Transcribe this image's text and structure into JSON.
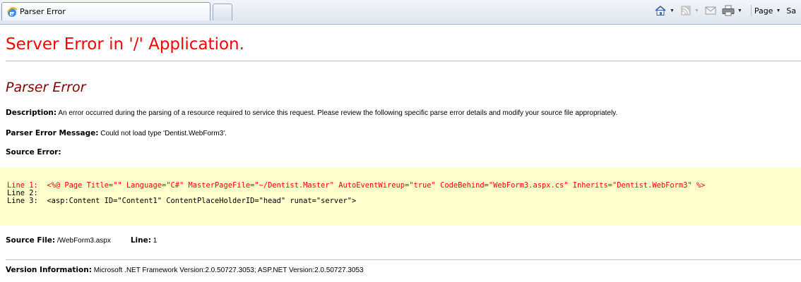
{
  "browser": {
    "tab_title": "Parser Error",
    "page_menu_label": "Page",
    "safety_menu_label_partial": "Sa",
    "icons": [
      "ie-logo-icon",
      "home-icon",
      "rss-feed-icon",
      "read-mail-icon",
      "print-icon"
    ]
  },
  "page": {
    "heading": "Server Error in '/' Application.",
    "error_title": "Parser Error",
    "description_label": "Description:",
    "description_text": " An error occurred during the parsing of a resource required to service this request. Please review the following specific parse error details and modify your source file appropriately.",
    "message_label": "Parser Error Message:",
    "message_text": " Could not load type 'Dentist.WebForm3'.",
    "source_error_label": "Source Error:",
    "source_lines": [
      {
        "label": "Line 1:  ",
        "code": "<%@ Page Title=\"\" Language=\"C#\" MasterPageFile=\"~/Dentist.Master\" AutoEventWireup=\"true\" CodeBehind=\"WebForm3.aspx.cs\" Inherits=\"Dentist.WebForm3\" %>"
      },
      {
        "label": "Line 2:",
        "code": ""
      },
      {
        "label": "Line 3:  ",
        "code": "<asp:Content ID=\"Content1\" ContentPlaceHolderID=\"head\" runat=\"server\">"
      }
    ],
    "source_file_label": "Source File:",
    "source_file_value": " /WebForm3.aspx",
    "line_label": "Line:",
    "line_value": " 1",
    "version_label": "Version Information:",
    "version_text": " Microsoft .NET Framework Version:2.0.50727.3053; ASP.NET Version:2.0.50727.3053"
  },
  "colors": {
    "heading": "#ff0000",
    "error_title": "#800000",
    "source_box": "#ffffcc",
    "source_error_line": "#ff0000"
  }
}
